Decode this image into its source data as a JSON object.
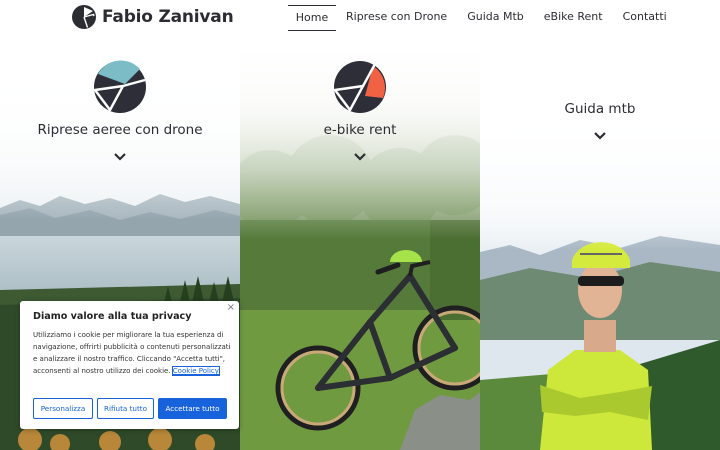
{
  "header": {
    "brand_name": "Fabio Zanivan",
    "nav": [
      {
        "label": "Home",
        "active": true
      },
      {
        "label": "Riprese con Drone",
        "active": false
      },
      {
        "label": "Guida Mtb",
        "active": false
      },
      {
        "label": "eBike Rent",
        "active": false
      },
      {
        "label": "Contatti",
        "active": false
      }
    ]
  },
  "services": [
    {
      "title": "Riprese aeree con drone",
      "icon": "drone-logo-icon",
      "accent_color": "#7cbcc6"
    },
    {
      "title": "e-bike rent",
      "icon": "ebike-logo-icon",
      "accent_color": "#f16244"
    },
    {
      "title": "Guida mtb",
      "icon": "none"
    }
  ],
  "cookie_banner": {
    "title": "Diamo valore alla tua privacy",
    "text": "Utilizziamo i cookie per migliorare la tua esperienza di navigazione, offrirti pubblicità o contenuti personalizzati e analizzare il nostro traffico. Cliccando \"Accetta tutti\", acconsenti al nostro utilizzo dei cookie.",
    "link_text": "Cookie Policy",
    "close_symbol": "×",
    "buttons": {
      "customize": "Personalizza",
      "reject": "Rifiuta tutto",
      "accept": "Accettare tutto"
    },
    "accent_color": "#1863dc"
  },
  "colors": {
    "text_dark": "#2c2c33"
  }
}
